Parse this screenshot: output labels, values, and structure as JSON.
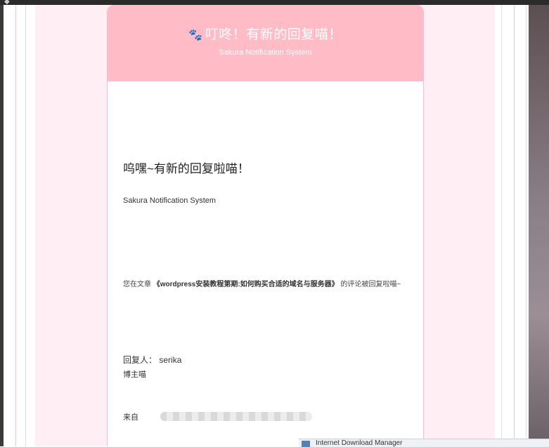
{
  "header": {
    "paw_icon": "paw-icon",
    "title": "叮咚！有新的回复喵！",
    "subtitle": "Sakura Notification System"
  },
  "body": {
    "heading": "呜嘿~有新的回复啦喵！",
    "system_name": "Sakura Notification System",
    "article_prefix": "您在文章",
    "article_title": "《wordpress安装教程第期:如何购买合适的域名与服务器》",
    "article_suffix": "的评论被回复啦喵~",
    "replier_label": "回复人：",
    "replier_name": "serika",
    "reply_content": "博主喵",
    "from_label": "来自"
  },
  "taskbar": {
    "item_label": "Internet Download Manager"
  },
  "colors": {
    "header_pink": "#ffbcc7",
    "page_pink": "#ffeef3"
  }
}
